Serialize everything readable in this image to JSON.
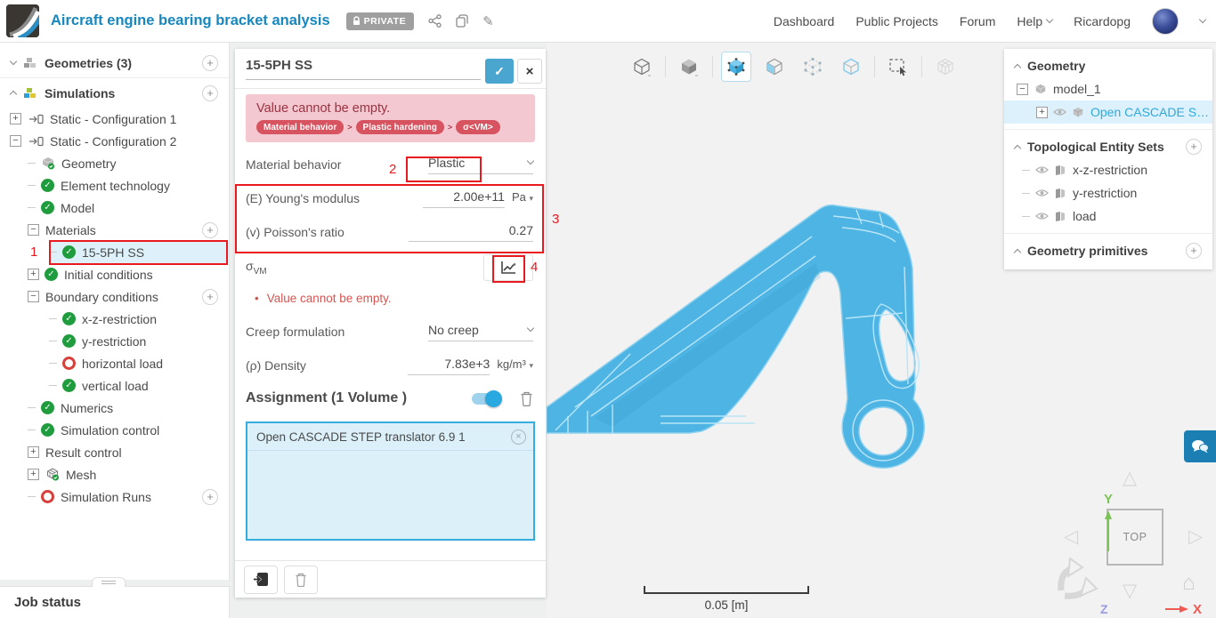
{
  "icons": {
    "check": "✓",
    "close": "×",
    "plus": "+",
    "minus": "−",
    "caret_down": "▾",
    "pencil": "✎",
    "bullet": "•",
    "gt": ">",
    "tri_up": "△",
    "tri_down": "▽",
    "tri_left": "◁",
    "tri_right": "▷",
    "home": "⌂"
  },
  "header": {
    "title": "Aircraft engine bearing bracket analysis",
    "privacy_badge": "PRIVATE",
    "nav": [
      "Dashboard",
      "Public Projects",
      "Forum",
      "Help"
    ],
    "username": "Ricardopg"
  },
  "sidebar": {
    "items": [
      {
        "label": "Geometries (3)"
      },
      {
        "label": "Simulations"
      },
      {
        "label": "Static - Configuration 1"
      },
      {
        "label": "Static - Configuration 2"
      },
      {
        "label": "Geometry"
      },
      {
        "label": "Element technology"
      },
      {
        "label": "Model"
      },
      {
        "label": "Materials"
      },
      {
        "label": "15-5PH SS"
      },
      {
        "label": "Initial conditions"
      },
      {
        "label": "Boundary conditions"
      },
      {
        "label": "x-z-restriction"
      },
      {
        "label": "y-restriction"
      },
      {
        "label": "horizontal load"
      },
      {
        "label": "vertical load"
      },
      {
        "label": "Numerics"
      },
      {
        "label": "Simulation control"
      },
      {
        "label": "Result control"
      },
      {
        "label": "Mesh"
      },
      {
        "label": "Simulation Runs"
      }
    ],
    "job_status": "Job status"
  },
  "panel": {
    "title": "15-5PH SS",
    "alert": {
      "message": "Value cannot be empty.",
      "path": [
        "Material behavior",
        "Plastic hardening",
        "σ<VM>"
      ]
    },
    "material_behavior": {
      "label": "Material behavior",
      "value": "Plastic"
    },
    "youngs_modulus": {
      "label": "(E) Young's modulus",
      "value": "2.00e+11",
      "unit": "Pa"
    },
    "poisson": {
      "label": "(v) Poisson's ratio",
      "value": "0.27"
    },
    "sigma": {
      "base": "σ",
      "sub": "VM",
      "error": "Value cannot be empty."
    },
    "creep": {
      "label": "Creep formulation",
      "value": "No creep"
    },
    "density": {
      "label": "(ρ) Density",
      "value": "7.83e+3",
      "unit": "kg/m³"
    },
    "assignment": {
      "label": "Assignment (1 Volume )",
      "chip": "Open CASCADE STEP translator 6.9 1"
    }
  },
  "scene_tree": {
    "geometry_header": "Geometry",
    "model": "model_1",
    "geometry_child": "Open CASCADE STE...",
    "topo_header": "Topological Entity Sets",
    "topo_items": [
      "x-z-restriction",
      "y-restriction",
      "load"
    ],
    "primitives_header": "Geometry primitives"
  },
  "viewport": {
    "scale_label": "0.05 [m]",
    "nav_cube_face": "TOP",
    "axes": {
      "x": "X",
      "y": "Y",
      "z": "Z"
    }
  },
  "annotations": [
    "1",
    "2",
    "3",
    "4"
  ]
}
